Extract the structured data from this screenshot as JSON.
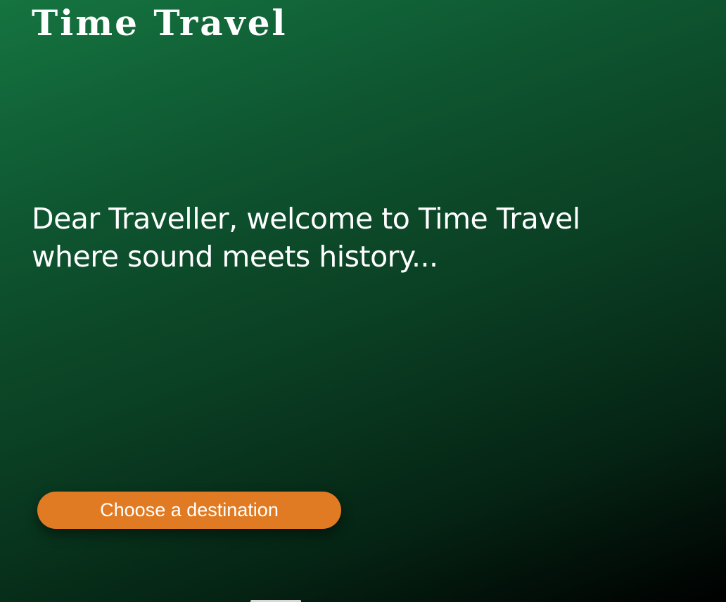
{
  "header": {
    "title": "Time Travel"
  },
  "hero": {
    "welcome_line_1": "Dear Traveller, welcome to Time Travel",
    "welcome_line_2": "where sound meets history..."
  },
  "cta": {
    "label": "Choose a destination"
  },
  "colors": {
    "accent": "#e07b24",
    "background_top": "#157440",
    "background_bottom": "#000000",
    "text": "#ffffff"
  }
}
